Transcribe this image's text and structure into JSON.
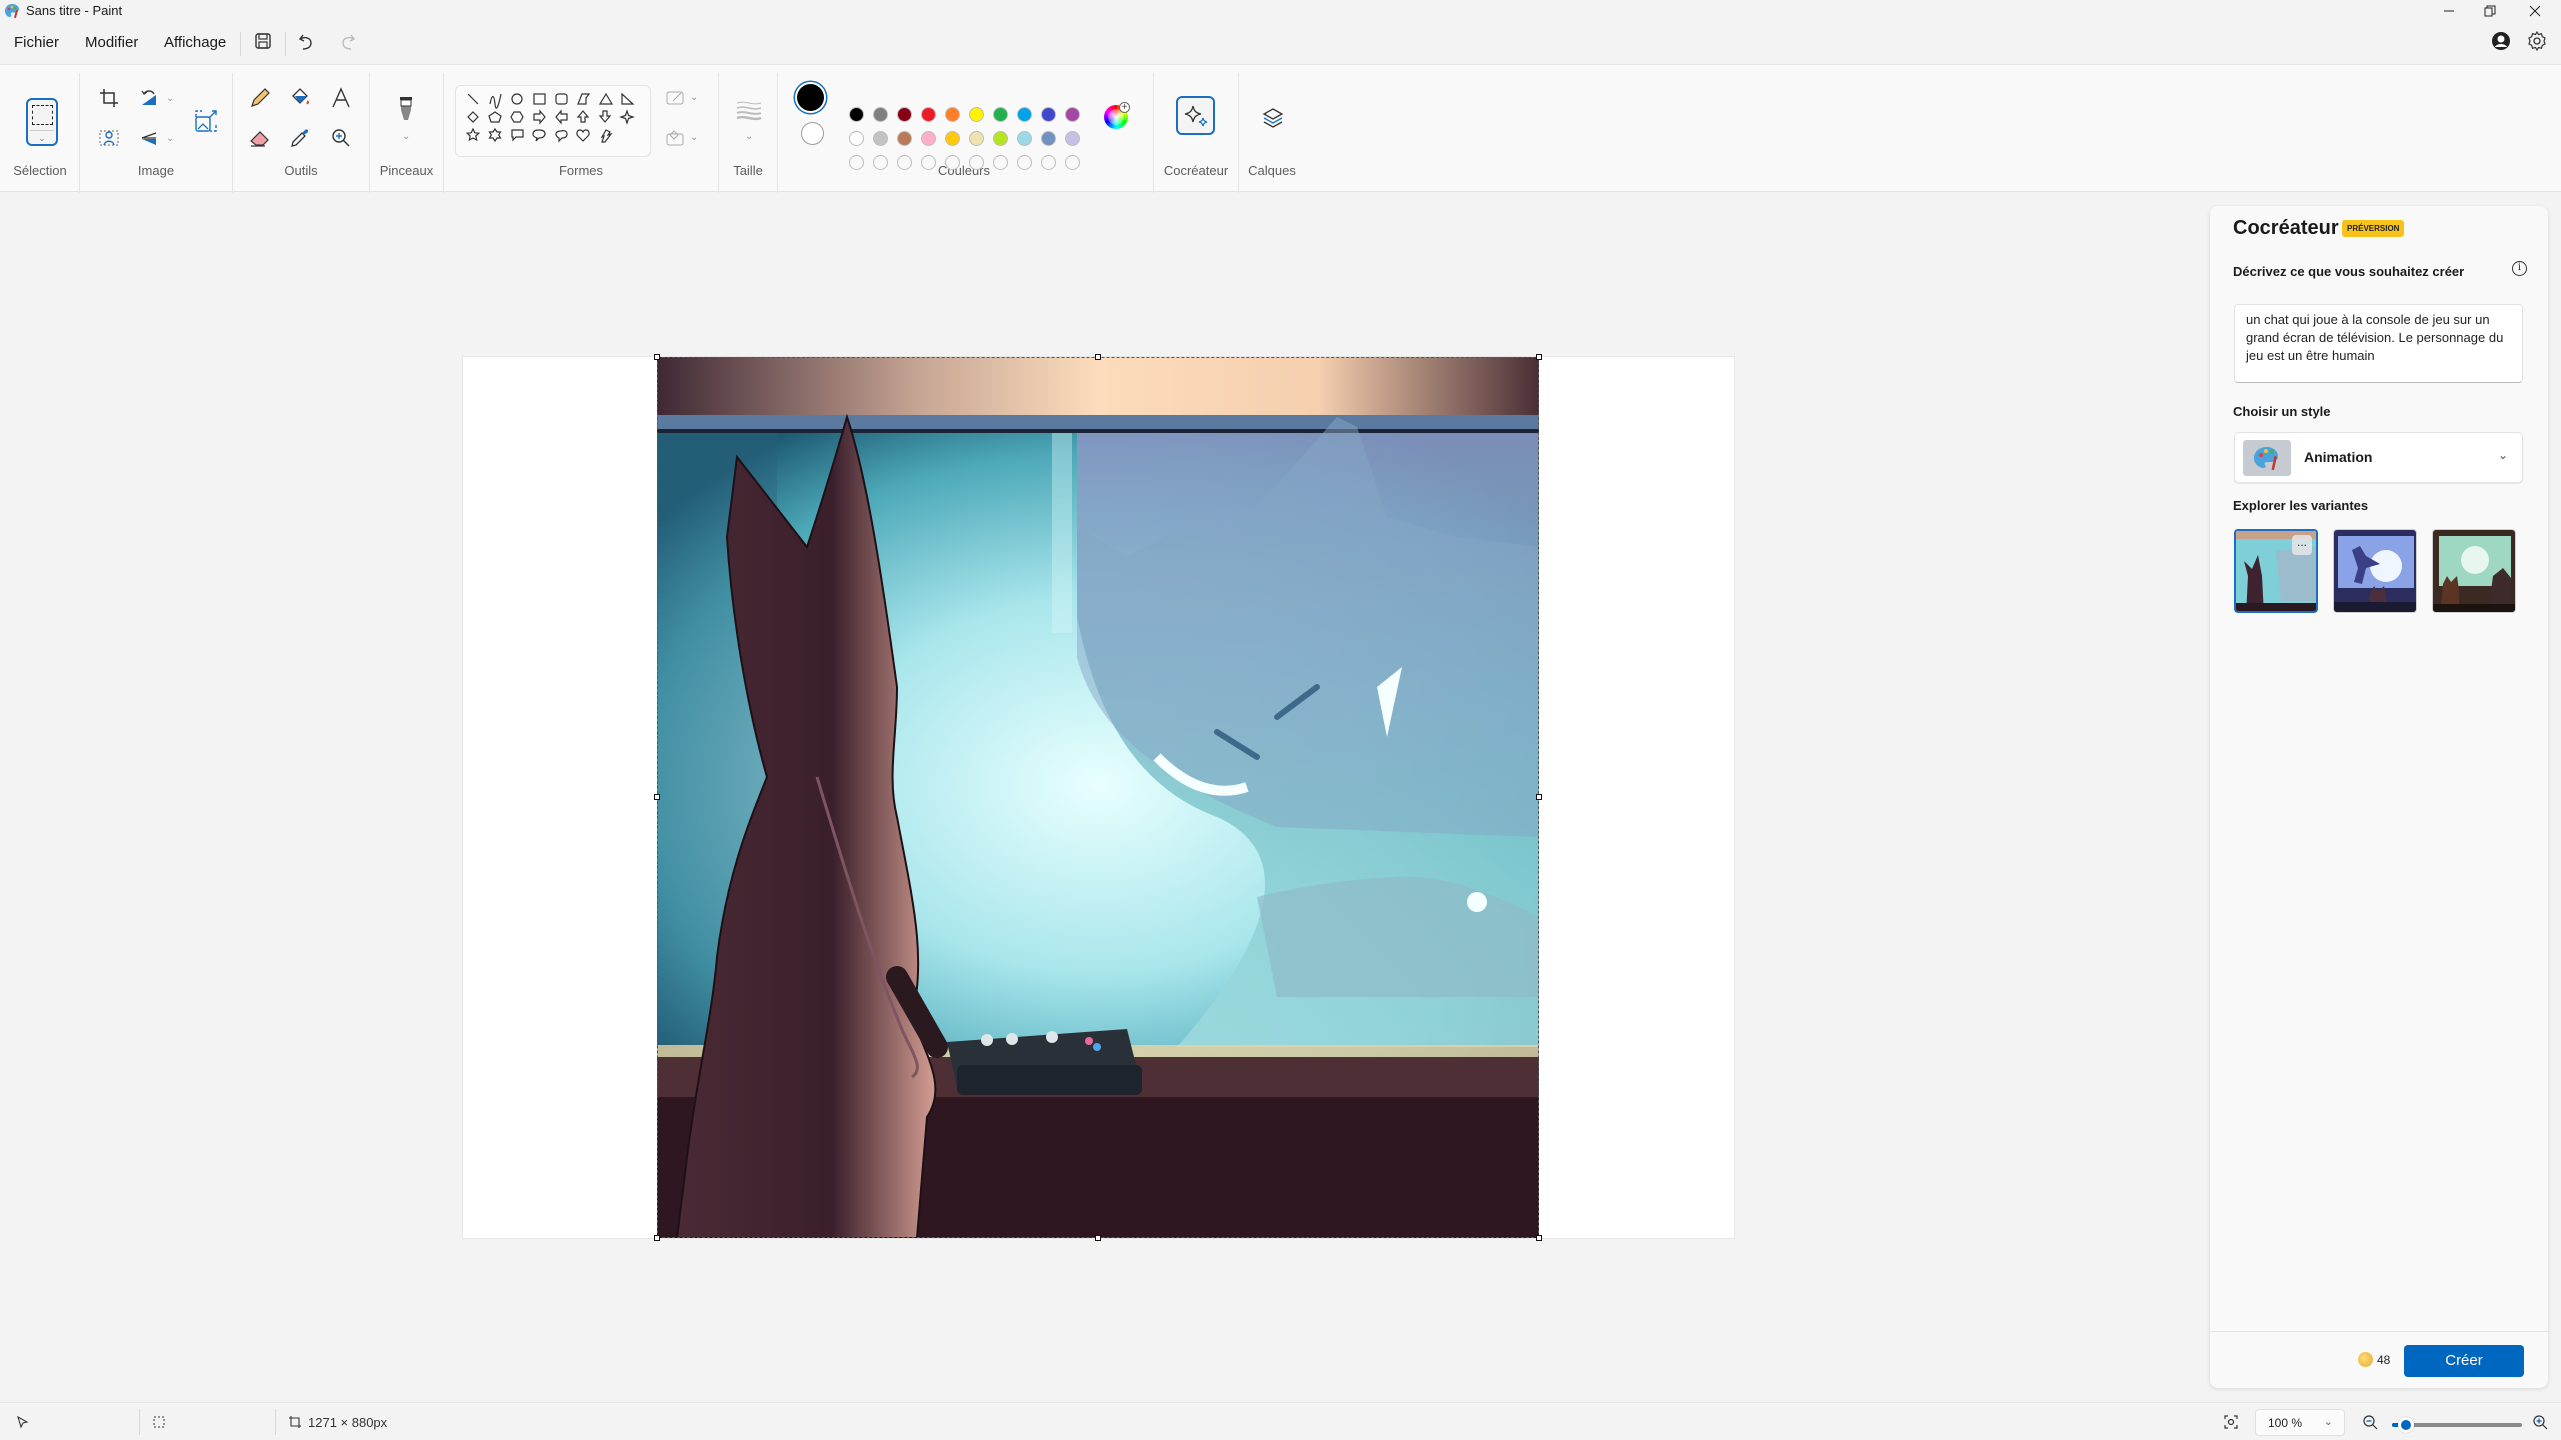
{
  "window": {
    "title": "Sans titre - Paint",
    "controls": [
      "minimize",
      "restore",
      "close"
    ]
  },
  "menu": {
    "items": [
      "Fichier",
      "Modifier",
      "Affichage"
    ],
    "quick_access": [
      "save-icon",
      "undo-icon",
      "redo-icon"
    ]
  },
  "ribbon": {
    "groups": {
      "selection": "Sélection",
      "image": "Image",
      "tools": "Outils",
      "brushes": "Pinceaux",
      "shapes": "Formes",
      "size": "Taille",
      "colors": "Couleurs",
      "cocreator": "Cocréateur",
      "layers": "Calques"
    },
    "shapes": [
      "line",
      "curve",
      "oval",
      "rectangle",
      "rounded-rectangle",
      "polygon",
      "triangle",
      "right-triangle",
      "diamond",
      "pentagon",
      "hexagon",
      "arrow-right",
      "arrow-left",
      "arrow-up",
      "arrow-down",
      "four-point-star",
      "five-point-star",
      "six-point-star",
      "rounded-callout",
      "oval-callout",
      "cloud-callout",
      "heart",
      "lightning"
    ],
    "colors": {
      "primary": "#000000",
      "secondary": "#ffffff",
      "row1": [
        "#000000",
        "#7f7f7f",
        "#880015",
        "#ed1c24",
        "#ff7f27",
        "#fff200",
        "#22b14c",
        "#00a2e8",
        "#3f48cc",
        "#a349a4"
      ],
      "row2": [
        "#ffffff",
        "#c3c3c3",
        "#b97a57",
        "#ffaec9",
        "#ffc90e",
        "#efe4b0",
        "#b5e61d",
        "#99d9ea",
        "#7092be",
        "#c8bfe7"
      ],
      "row3_custom_empty": 10
    }
  },
  "cocreator_panel": {
    "title": "Cocréateur",
    "badge": "PRÉVERSION",
    "prompt_label": "Décrivez ce que vous souhaitez créer",
    "prompt_value": "un chat qui joue à la console de jeu sur un grand écran de télévision. Le personnage du jeu est un être humain",
    "style_label": "Choisir un style",
    "style_value": "Animation",
    "variants_label": "Explorer les variantes",
    "variants": [
      {
        "name": "variant-1",
        "selected": true
      },
      {
        "name": "variant-2",
        "selected": false
      },
      {
        "name": "variant-3",
        "selected": false
      }
    ],
    "more_label": "...",
    "credits": "48",
    "create_label": "Créer"
  },
  "statusbar": {
    "canvas_size": "1271 × 880px",
    "zoom": "100 %",
    "zoom_slider_fraction": 0.11
  },
  "canvas": {
    "image_description": "Illustration de style animation : un chaton vu de dos devant un grand écran montrant un chat géant, console de jeu sur le rebord"
  }
}
